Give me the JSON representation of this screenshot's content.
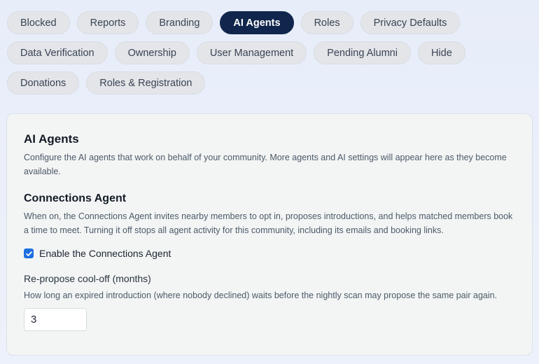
{
  "tabs": [
    {
      "label": "Blocked",
      "active": false
    },
    {
      "label": "Reports",
      "active": false
    },
    {
      "label": "Branding",
      "active": false
    },
    {
      "label": "AI Agents",
      "active": true
    },
    {
      "label": "Roles",
      "active": false
    },
    {
      "label": "Privacy Defaults",
      "active": false
    },
    {
      "label": "Data Verification",
      "active": false
    },
    {
      "label": "Ownership",
      "active": false
    },
    {
      "label": "User Management",
      "active": false
    },
    {
      "label": "Pending Alumni",
      "active": false
    },
    {
      "label": "Hide",
      "active": false
    },
    {
      "label": "Donations",
      "active": false
    },
    {
      "label": "Roles & Registration",
      "active": false
    }
  ],
  "panel": {
    "title": "AI Agents",
    "description": "Configure the AI agents that work on behalf of your community. More agents and AI settings will appear here as they become available.",
    "connections_agent": {
      "title": "Connections Agent",
      "description": "When on, the Connections Agent invites nearby members to opt in, proposes introductions, and helps matched members book a time to meet. Turning it off stops all agent activity for this community, including its emails and booking links.",
      "enable_label": "Enable the Connections Agent",
      "enabled": true,
      "cooloff_label": "Re-propose cool-off (months)",
      "cooloff_description": "How long an expired introduction (where nobody declined) waits before the nightly scan may propose the same pair again.",
      "cooloff_value": "3"
    }
  },
  "colors": {
    "active_tab": "#10264c",
    "checkbox": "#1d6fe0"
  }
}
